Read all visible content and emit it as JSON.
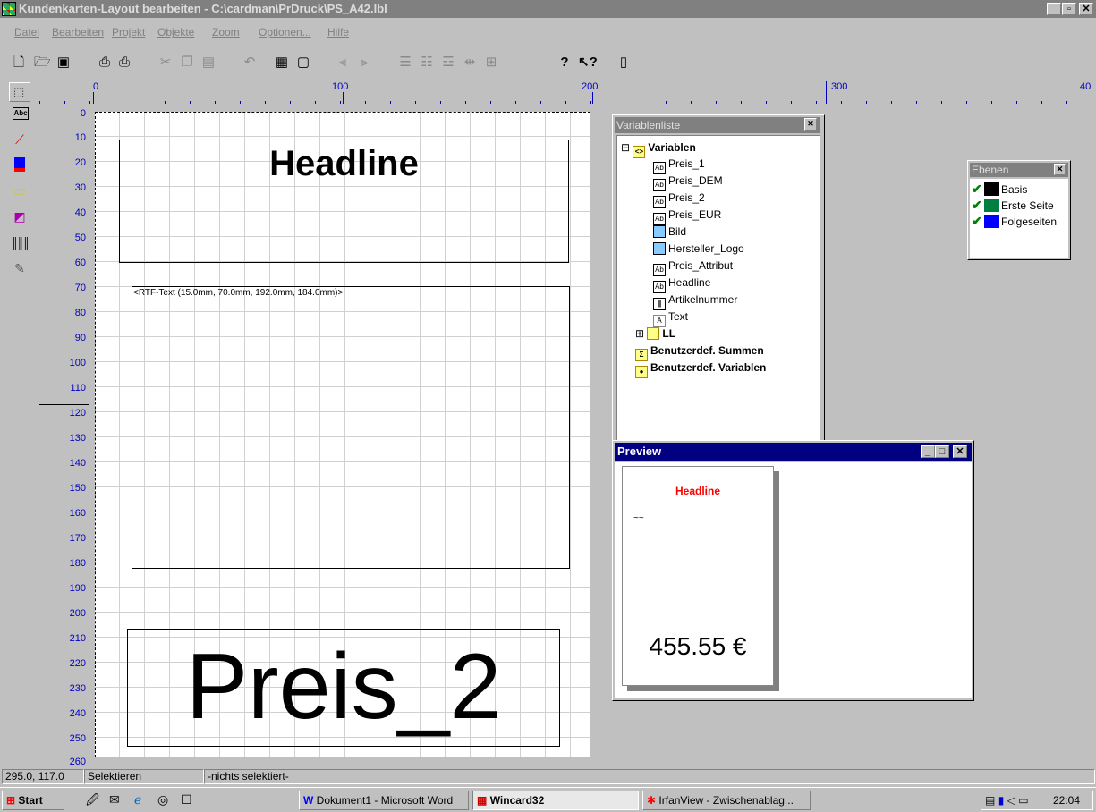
{
  "window": {
    "title": "Kundenkarten-Layout bearbeiten - C:\\cardman\\PrDruck\\PS_A42.lbl",
    "controls": {
      "minimize": "_",
      "maximize": "▫",
      "close": "✕"
    }
  },
  "menu": [
    "Datei",
    "Bearbeiten",
    "Projekt",
    "Objekte",
    "Zoom",
    "Optionen...",
    "Hilfe"
  ],
  "toolbar": {
    "icons": [
      "new-file-icon",
      "open-folder-icon",
      "save-icon",
      "print-icon",
      "print-preview-icon",
      "cut-icon",
      "copy-icon",
      "paste-icon",
      "undo-icon",
      "object-props-icon",
      "page-setup-icon",
      "align-left-icon",
      "align-right-icon",
      "align-top-icon",
      "align-bottom-icon",
      "space-horizontal-icon",
      "space-vertical-icon",
      "center-icon",
      "help-icon",
      "context-help-icon",
      "exit-icon"
    ]
  },
  "left_tools": [
    "select-tool-icon",
    "text-tool-icon",
    "line-tool-icon",
    "rectangle-tool-icon",
    "ellipse-tool-icon",
    "chart-tool-icon",
    "barcode-tool-icon",
    "rtf-tool-icon"
  ],
  "ruler": {
    "h_labels": [
      "0",
      "100",
      "200",
      "300",
      "40"
    ],
    "v_labels": [
      "0",
      "10",
      "20",
      "30",
      "40",
      "50",
      "60",
      "70",
      "80",
      "90",
      "100",
      "110",
      "120",
      "130",
      "140",
      "150",
      "160",
      "170",
      "180",
      "190",
      "200",
      "210",
      "220",
      "230",
      "240",
      "250",
      "260"
    ]
  },
  "layout": {
    "headline": "Headline",
    "rtf_label": "<RTF-Text (15.0mm, 70.0mm, 192.0mm, 184.0mm)>",
    "price": "Preis_2"
  },
  "varlist": {
    "title": "Variablenliste",
    "root": "Variablen",
    "root_expander": "⊟",
    "items": [
      {
        "label": "Preis_1",
        "icon": "text-var-icon"
      },
      {
        "label": "Preis_DEM",
        "icon": "text-var-icon"
      },
      {
        "label": "Preis_2",
        "icon": "text-var-icon"
      },
      {
        "label": "Preis_EUR",
        "icon": "text-var-icon"
      },
      {
        "label": "Bild",
        "icon": "image-var-icon"
      },
      {
        "label": "Hersteller_Logo",
        "icon": "image-var-icon"
      },
      {
        "label": "Preis_Attribut",
        "icon": "text-var-icon"
      },
      {
        "label": "Headline",
        "icon": "text-var-icon"
      },
      {
        "label": "Artikelnummer",
        "icon": "barcode-var-icon"
      },
      {
        "label": "Text",
        "icon": "rtf-var-icon"
      }
    ],
    "ll": "LL",
    "ll_expander": "⊞",
    "sum": "Benutzerdef. Summen",
    "uservars": "Benutzerdef. Variablen"
  },
  "ebenen": {
    "title": "Ebenen",
    "layers": [
      {
        "label": "Basis",
        "color": "#000000"
      },
      {
        "label": "Erste Seite",
        "color": "#008040"
      },
      {
        "label": "Folgeseiten",
        "color": "#0000ff"
      }
    ]
  },
  "preview": {
    "title": "Preview",
    "headline": "Headline",
    "headline_color": "#ff0000",
    "squiggle": "~~",
    "price": "455.55 €"
  },
  "status": {
    "coords": "295.0, 117.0",
    "mode": "Selektieren",
    "selection": "-nichts selektiert-"
  },
  "taskbar": {
    "start": "Start",
    "tasks": [
      "Dokument1 - Microsoft Word",
      "Wincard32",
      "IrfanView - Zwischenablag..."
    ],
    "active": "Wincard32",
    "clock": "22:04"
  }
}
